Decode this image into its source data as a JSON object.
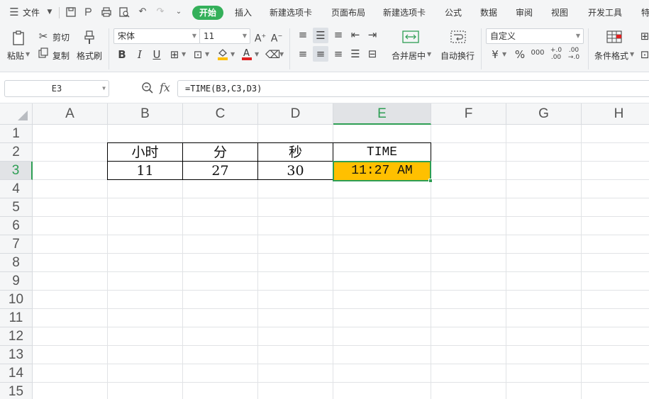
{
  "menubar": {
    "menu_label": "文件",
    "tabs": [
      "开始",
      "插入",
      "新建选项卡",
      "页面布局",
      "新建选项卡",
      "公式",
      "数据",
      "审阅",
      "视图",
      "开发工具",
      "特"
    ]
  },
  "ribbon": {
    "paste": "粘贴",
    "cut": "剪切",
    "copy": "复制",
    "format_painter": "格式刷",
    "font_name": "宋体",
    "font_size": "11",
    "merge_center": "合并居中",
    "wrap_text": "自动换行",
    "number_format": "自定义",
    "conditional_format": "条件格式",
    "currency_symbol": "¥",
    "percent_symbol": "%",
    "thousands_symbol": "000"
  },
  "formula_bar": {
    "name_box": "E3",
    "fx": "fx",
    "formula": "=TIME(B3,C3,D3)"
  },
  "grid": {
    "columns": [
      "A",
      "B",
      "C",
      "D",
      "E",
      "F",
      "G",
      "H"
    ],
    "rows": [
      "1",
      "2",
      "3",
      "4",
      "5",
      "6",
      "7",
      "8",
      "9",
      "10",
      "11",
      "12",
      "13",
      "14",
      "15"
    ],
    "selected_column": "E",
    "selected_row": "3"
  },
  "table": {
    "headers": [
      "小时",
      "分",
      "秒",
      "TIME"
    ],
    "row3": [
      "11",
      "27",
      "30",
      "11:27 AM"
    ]
  },
  "colors": {
    "accent": "#34b05a",
    "selection": "#2e9e54",
    "highlight_fill": "#ffc000"
  }
}
